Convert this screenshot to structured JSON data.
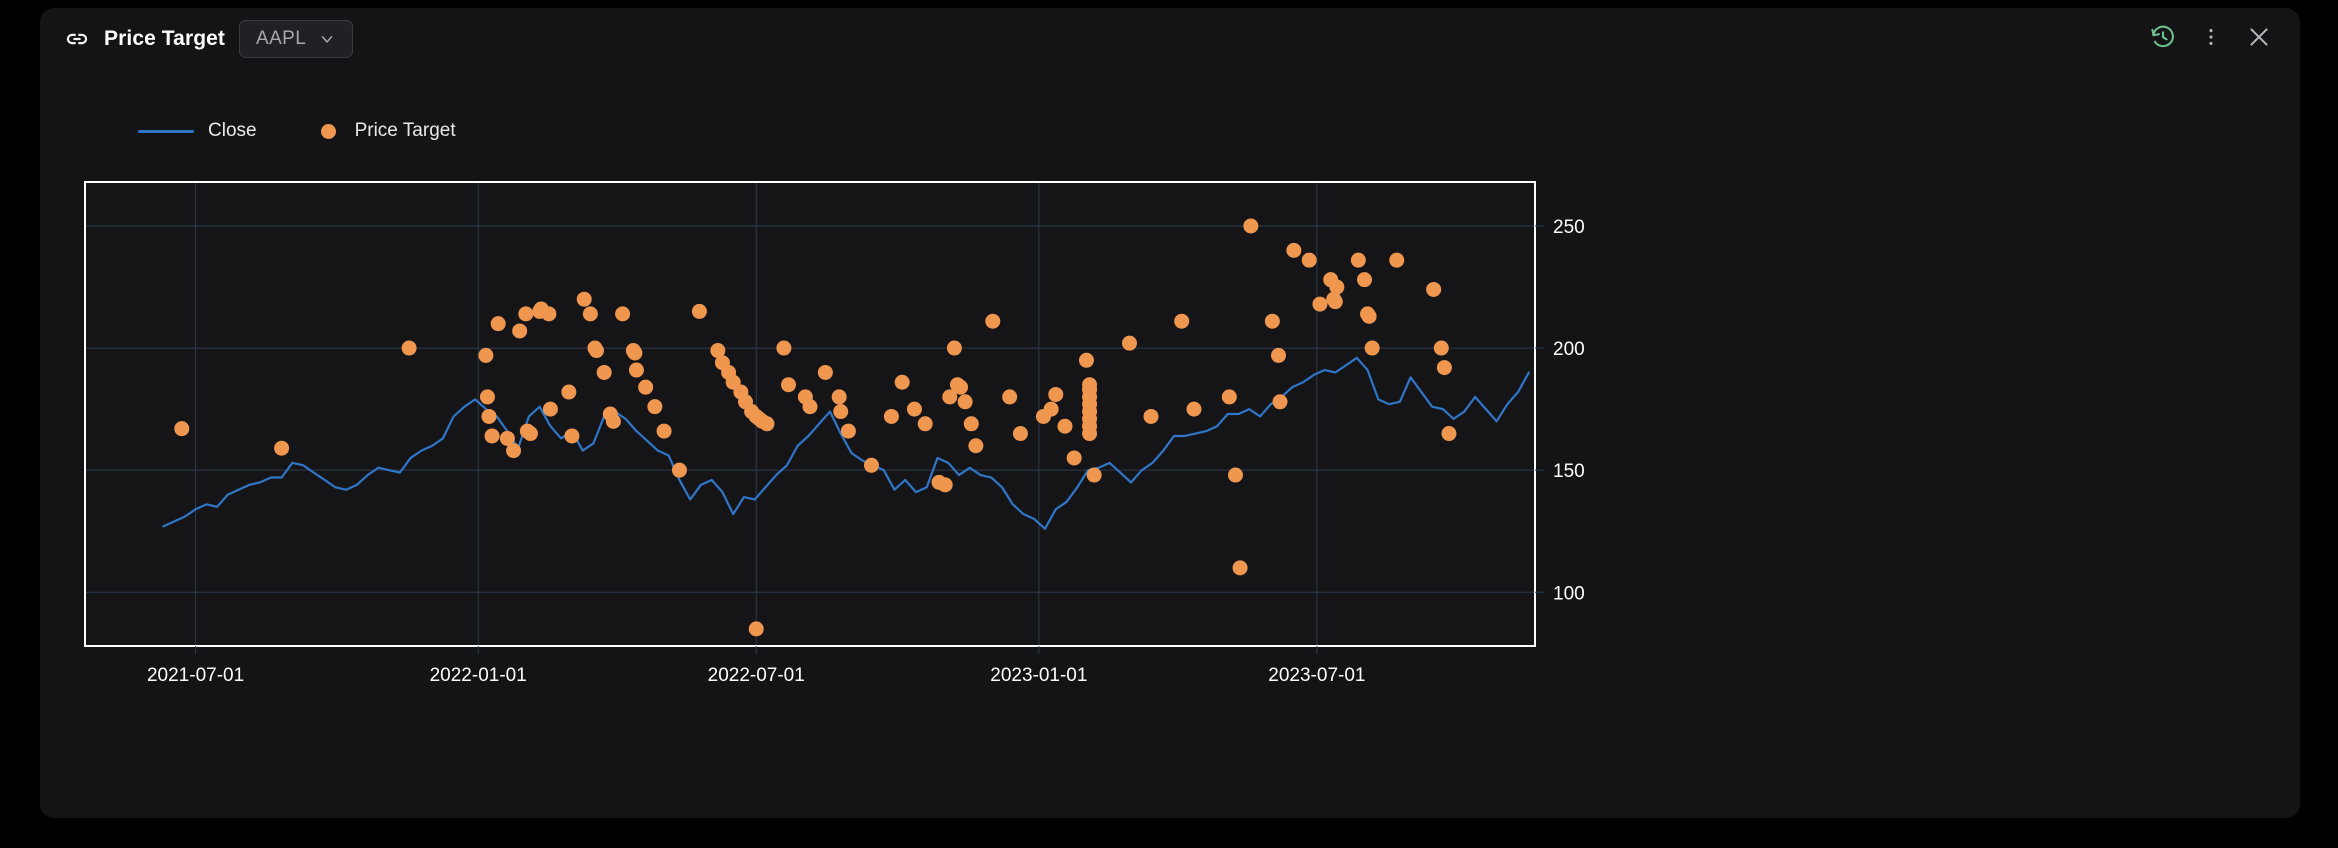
{
  "window": {
    "title": "Price Target",
    "link_icon": "link-icon",
    "ticker": {
      "value": "AAPL",
      "chevron": "chevron-down-icon"
    },
    "controls": [
      {
        "name": "history-icon",
        "label": "History",
        "color": "#6cc28f"
      },
      {
        "name": "more-vertical-icon",
        "label": "More",
        "color": "#b6b6bd"
      },
      {
        "name": "close-icon",
        "label": "Close",
        "color": "#b6b6bd"
      }
    ]
  },
  "colors": {
    "page_background": "#000000",
    "card_background": "#141417",
    "plot_background": "#151518",
    "plot_border": "#ffffff",
    "grid": "#2c3a4c",
    "close_line": "#2f76c8",
    "price_target_dot": "#f0974f",
    "axis_text": "#ffffff",
    "title_text": "#ffffff",
    "ticker_text": "#a7a7ae"
  },
  "chart_data": {
    "type": "line",
    "title": "Price Target",
    "xlabel": "",
    "ylabel": "",
    "grid": true,
    "legend_position": "top-left",
    "xlim": [
      "2021-04-20",
      "2023-11-20"
    ],
    "ylim": [
      78,
      268
    ],
    "yticks": [
      100,
      150,
      200,
      250
    ],
    "ytick_labels": [
      "100",
      "150",
      "200",
      "250"
    ],
    "xticks": [
      "2021-07-01",
      "2022-01-01",
      "2022-07-01",
      "2023-01-01",
      "2023-07-01"
    ],
    "xtick_labels": [
      "2021-07-01",
      "2022-01-01",
      "2022-07-01",
      "2023-01-01",
      "2023-07-01"
    ],
    "series": [
      {
        "name": "Close",
        "type": "line",
        "color": "#2f76c8",
        "x": [
          "2021-06-10",
          "2021-06-17",
          "2021-06-24",
          "2021-07-01",
          "2021-07-08",
          "2021-07-15",
          "2021-07-22",
          "2021-07-29",
          "2021-08-05",
          "2021-08-12",
          "2021-08-19",
          "2021-08-26",
          "2021-09-02",
          "2021-09-09",
          "2021-09-16",
          "2021-09-23",
          "2021-09-30",
          "2021-10-07",
          "2021-10-14",
          "2021-10-21",
          "2021-10-28",
          "2021-11-04",
          "2021-11-11",
          "2021-11-18",
          "2021-11-25",
          "2021-12-02",
          "2021-12-09",
          "2021-12-16",
          "2021-12-23",
          "2021-12-30",
          "2022-01-06",
          "2022-01-13",
          "2022-01-20",
          "2022-01-27",
          "2022-02-03",
          "2022-02-10",
          "2022-02-17",
          "2022-02-24",
          "2022-03-03",
          "2022-03-10",
          "2022-03-17",
          "2022-03-24",
          "2022-03-31",
          "2022-04-07",
          "2022-04-14",
          "2022-04-21",
          "2022-04-28",
          "2022-05-05",
          "2022-05-12",
          "2022-05-19",
          "2022-05-26",
          "2022-06-02",
          "2022-06-09",
          "2022-06-16",
          "2022-06-23",
          "2022-06-30",
          "2022-07-07",
          "2022-07-14",
          "2022-07-21",
          "2022-07-28",
          "2022-08-04",
          "2022-08-11",
          "2022-08-18",
          "2022-08-25",
          "2022-09-01",
          "2022-09-08",
          "2022-09-15",
          "2022-09-22",
          "2022-09-29",
          "2022-10-06",
          "2022-10-13",
          "2022-10-20",
          "2022-10-27",
          "2022-11-03",
          "2022-11-10",
          "2022-11-17",
          "2022-11-24",
          "2022-12-01",
          "2022-12-08",
          "2022-12-15",
          "2022-12-22",
          "2022-12-29",
          "2023-01-05",
          "2023-01-12",
          "2023-01-19",
          "2023-01-26",
          "2023-02-02",
          "2023-02-09",
          "2023-02-16",
          "2023-02-23",
          "2023-03-02",
          "2023-03-09",
          "2023-03-16",
          "2023-03-23",
          "2023-03-30",
          "2023-04-06",
          "2023-04-13",
          "2023-04-20",
          "2023-04-27",
          "2023-05-04",
          "2023-05-11",
          "2023-05-18",
          "2023-05-25",
          "2023-06-01",
          "2023-06-08",
          "2023-06-15",
          "2023-06-22",
          "2023-06-29",
          "2023-07-06",
          "2023-07-13",
          "2023-07-20",
          "2023-07-27",
          "2023-08-03",
          "2023-08-10",
          "2023-08-17",
          "2023-08-24",
          "2023-08-31",
          "2023-09-07",
          "2023-09-14",
          "2023-09-21",
          "2023-09-28",
          "2023-10-05",
          "2023-10-12",
          "2023-10-19",
          "2023-10-26",
          "2023-11-02",
          "2023-11-09",
          "2023-11-16"
        ],
        "y": [
          127,
          129,
          131,
          134,
          136,
          135,
          140,
          142,
          144,
          145,
          147,
          147,
          153,
          152,
          149,
          146,
          143,
          142,
          144,
          148,
          151,
          150,
          149,
          155,
          158,
          160,
          163,
          172,
          176,
          179,
          175,
          172,
          166,
          159,
          172,
          176,
          168,
          163,
          166,
          158,
          161,
          172,
          174,
          171,
          166,
          162,
          158,
          156,
          146,
          138,
          144,
          146,
          141,
          132,
          139,
          138,
          143,
          148,
          152,
          160,
          164,
          169,
          174,
          165,
          157,
          154,
          152,
          150,
          142,
          146,
          141,
          143,
          155,
          153,
          148,
          151,
          148,
          147,
          143,
          136,
          132,
          130,
          126,
          134,
          137,
          143,
          150,
          151,
          153,
          149,
          145,
          150,
          153,
          158,
          164,
          164,
          165,
          166,
          168,
          173,
          173,
          175,
          172,
          177,
          180,
          184,
          186,
          189,
          191,
          190,
          193,
          196,
          191,
          179,
          177,
          178,
          188,
          182,
          176,
          175,
          171,
          174,
          180,
          175,
          170,
          177,
          182,
          190
        ]
      },
      {
        "name": "Price Target",
        "type": "scatter",
        "color": "#f0974f",
        "points": [
          {
            "date": "2021-06-22",
            "value": 167
          },
          {
            "date": "2021-08-26",
            "value": 159
          },
          {
            "date": "2021-11-17",
            "value": 200
          },
          {
            "date": "2022-01-06",
            "value": 197
          },
          {
            "date": "2022-01-07",
            "value": 180
          },
          {
            "date": "2022-01-08",
            "value": 172
          },
          {
            "date": "2022-01-10",
            "value": 164
          },
          {
            "date": "2022-01-14",
            "value": 210
          },
          {
            "date": "2022-01-20",
            "value": 163
          },
          {
            "date": "2022-01-24",
            "value": 158
          },
          {
            "date": "2022-01-28",
            "value": 207
          },
          {
            "date": "2022-02-01",
            "value": 214
          },
          {
            "date": "2022-02-02",
            "value": 166
          },
          {
            "date": "2022-02-04",
            "value": 165
          },
          {
            "date": "2022-02-10",
            "value": 215
          },
          {
            "date": "2022-02-11",
            "value": 216
          },
          {
            "date": "2022-02-16",
            "value": 214
          },
          {
            "date": "2022-02-17",
            "value": 175
          },
          {
            "date": "2022-03-01",
            "value": 182
          },
          {
            "date": "2022-03-03",
            "value": 164
          },
          {
            "date": "2022-03-11",
            "value": 220
          },
          {
            "date": "2022-03-15",
            "value": 214
          },
          {
            "date": "2022-03-18",
            "value": 200
          },
          {
            "date": "2022-03-19",
            "value": 199
          },
          {
            "date": "2022-03-24",
            "value": 190
          },
          {
            "date": "2022-03-28",
            "value": 173
          },
          {
            "date": "2022-03-30",
            "value": 170
          },
          {
            "date": "2022-04-05",
            "value": 214
          },
          {
            "date": "2022-04-12",
            "value": 199
          },
          {
            "date": "2022-04-13",
            "value": 198
          },
          {
            "date": "2022-04-14",
            "value": 191
          },
          {
            "date": "2022-04-20",
            "value": 184
          },
          {
            "date": "2022-04-26",
            "value": 176
          },
          {
            "date": "2022-05-02",
            "value": 166
          },
          {
            "date": "2022-05-12",
            "value": 150
          },
          {
            "date": "2022-05-25",
            "value": 215
          },
          {
            "date": "2022-06-06",
            "value": 199
          },
          {
            "date": "2022-06-09",
            "value": 194
          },
          {
            "date": "2022-06-13",
            "value": 190
          },
          {
            "date": "2022-06-16",
            "value": 186
          },
          {
            "date": "2022-06-21",
            "value": 182
          },
          {
            "date": "2022-06-24",
            "value": 178
          },
          {
            "date": "2022-06-28",
            "value": 174
          },
          {
            "date": "2022-07-01",
            "value": 172
          },
          {
            "date": "2022-07-03",
            "value": 171
          },
          {
            "date": "2022-07-05",
            "value": 170
          },
          {
            "date": "2022-07-08",
            "value": 169
          },
          {
            "date": "2022-07-01",
            "value": 85
          },
          {
            "date": "2022-07-19",
            "value": 200
          },
          {
            "date": "2022-07-22",
            "value": 185
          },
          {
            "date": "2022-08-02",
            "value": 180
          },
          {
            "date": "2022-08-05",
            "value": 176
          },
          {
            "date": "2022-08-15",
            "value": 190
          },
          {
            "date": "2022-08-24",
            "value": 180
          },
          {
            "date": "2022-08-25",
            "value": 174
          },
          {
            "date": "2022-08-30",
            "value": 166
          },
          {
            "date": "2022-09-14",
            "value": 152
          },
          {
            "date": "2022-09-27",
            "value": 172
          },
          {
            "date": "2022-10-04",
            "value": 186
          },
          {
            "date": "2022-10-12",
            "value": 175
          },
          {
            "date": "2022-10-19",
            "value": 169
          },
          {
            "date": "2022-10-28",
            "value": 145
          },
          {
            "date": "2022-11-01",
            "value": 144
          },
          {
            "date": "2022-11-04",
            "value": 180
          },
          {
            "date": "2022-11-07",
            "value": 200
          },
          {
            "date": "2022-11-09",
            "value": 185
          },
          {
            "date": "2022-11-11",
            "value": 184
          },
          {
            "date": "2022-11-14",
            "value": 178
          },
          {
            "date": "2022-11-18",
            "value": 169
          },
          {
            "date": "2022-11-21",
            "value": 160
          },
          {
            "date": "2022-12-02",
            "value": 211
          },
          {
            "date": "2022-12-13",
            "value": 180
          },
          {
            "date": "2022-12-20",
            "value": 165
          },
          {
            "date": "2023-01-04",
            "value": 172
          },
          {
            "date": "2023-01-09",
            "value": 175
          },
          {
            "date": "2023-01-12",
            "value": 181
          },
          {
            "date": "2023-01-18",
            "value": 168
          },
          {
            "date": "2023-01-24",
            "value": 155
          },
          {
            "date": "2023-02-01",
            "value": 195
          },
          {
            "date": "2023-02-03",
            "value": 185
          },
          {
            "date": "2023-02-03",
            "value": 183
          },
          {
            "date": "2023-02-03",
            "value": 180
          },
          {
            "date": "2023-02-03",
            "value": 177
          },
          {
            "date": "2023-02-03",
            "value": 174
          },
          {
            "date": "2023-02-03",
            "value": 171
          },
          {
            "date": "2023-02-03",
            "value": 168
          },
          {
            "date": "2023-02-03",
            "value": 165
          },
          {
            "date": "2023-02-06",
            "value": 148
          },
          {
            "date": "2023-03-01",
            "value": 202
          },
          {
            "date": "2023-03-15",
            "value": 172
          },
          {
            "date": "2023-04-04",
            "value": 211
          },
          {
            "date": "2023-04-12",
            "value": 175
          },
          {
            "date": "2023-05-05",
            "value": 180
          },
          {
            "date": "2023-05-09",
            "value": 148
          },
          {
            "date": "2023-05-12",
            "value": 110
          },
          {
            "date": "2023-05-19",
            "value": 250
          },
          {
            "date": "2023-06-02",
            "value": 211
          },
          {
            "date": "2023-06-06",
            "value": 197
          },
          {
            "date": "2023-06-07",
            "value": 178
          },
          {
            "date": "2023-06-16",
            "value": 240
          },
          {
            "date": "2023-06-26",
            "value": 236
          },
          {
            "date": "2023-07-03",
            "value": 218
          },
          {
            "date": "2023-07-10",
            "value": 228
          },
          {
            "date": "2023-07-12",
            "value": 220
          },
          {
            "date": "2023-07-13",
            "value": 219
          },
          {
            "date": "2023-07-14",
            "value": 225
          },
          {
            "date": "2023-07-28",
            "value": 236
          },
          {
            "date": "2023-08-01",
            "value": 228
          },
          {
            "date": "2023-08-03",
            "value": 214
          },
          {
            "date": "2023-08-04",
            "value": 213
          },
          {
            "date": "2023-08-06",
            "value": 200
          },
          {
            "date": "2023-08-22",
            "value": 236
          },
          {
            "date": "2023-09-15",
            "value": 224
          },
          {
            "date": "2023-09-20",
            "value": 200
          },
          {
            "date": "2023-09-22",
            "value": 192
          },
          {
            "date": "2023-09-25",
            "value": 165
          }
        ]
      }
    ]
  }
}
